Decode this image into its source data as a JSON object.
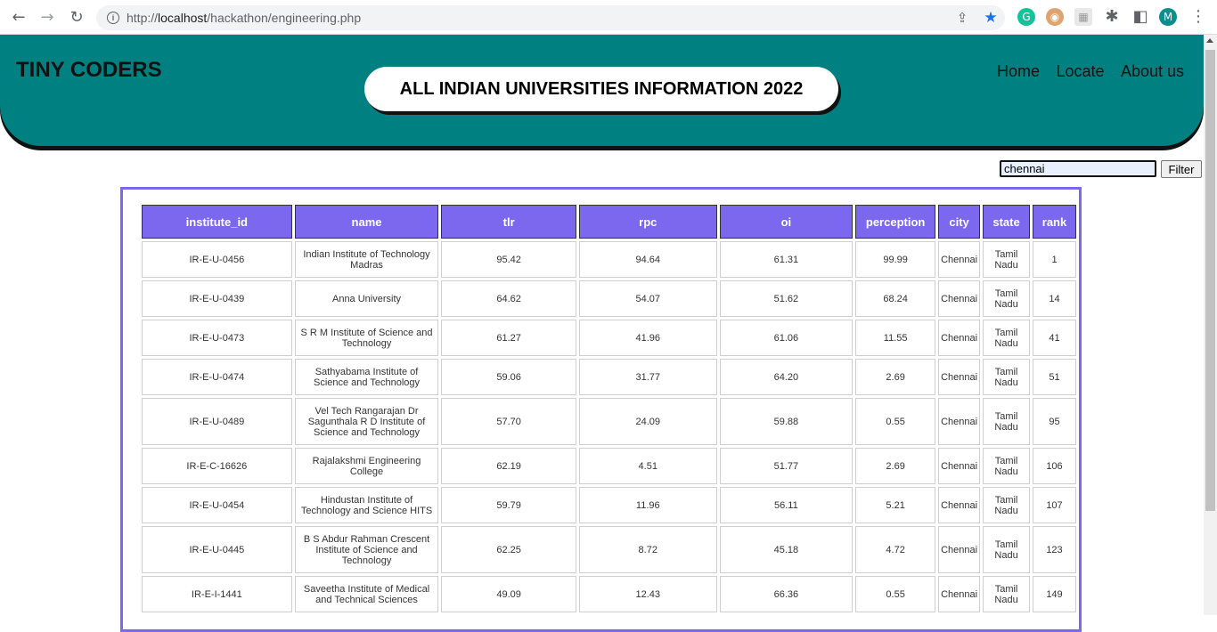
{
  "browser": {
    "url_scheme": "http://",
    "url_host": "localhost",
    "url_path": "/hackathon/engineering.php",
    "profile_initial": "M"
  },
  "header": {
    "brand": "TINY CODERS",
    "title": "ALL INDIAN UNIVERSITIES INFORMATION 2022",
    "nav": [
      "Home",
      "Locate",
      "About us"
    ]
  },
  "filter": {
    "value": "chennai",
    "button_label": "Filter"
  },
  "table": {
    "columns": [
      "institute_id",
      "name",
      "tlr",
      "rpc",
      "oi",
      "perception",
      "city",
      "state",
      "rank"
    ],
    "rows": [
      [
        "IR-E-U-0456",
        "Indian Institute of Technology Madras",
        "95.42",
        "94.64",
        "61.31",
        "99.99",
        "Chennai",
        "Tamil Nadu",
        "1"
      ],
      [
        "IR-E-U-0439",
        "Anna University",
        "64.62",
        "54.07",
        "51.62",
        "68.24",
        "Chennai",
        "Tamil Nadu",
        "14"
      ],
      [
        "IR-E-U-0473",
        "S R M Institute of Science and Technology",
        "61.27",
        "41.96",
        "61.06",
        "11.55",
        "Chennai",
        "Tamil Nadu",
        "41"
      ],
      [
        "IR-E-U-0474",
        "Sathyabama Institute of Science and Technology",
        "59.06",
        "31.77",
        "64.20",
        "2.69",
        "Chennai",
        "Tamil Nadu",
        "51"
      ],
      [
        "IR-E-U-0489",
        "Vel Tech Rangarajan Dr Sagunthala R D Institute of Science and Technology",
        "57.70",
        "24.09",
        "59.88",
        "0.55",
        "Chennai",
        "Tamil Nadu",
        "95"
      ],
      [
        "IR-E-C-16626",
        "Rajalakshmi Engineering College",
        "62.19",
        "4.51",
        "51.77",
        "2.69",
        "Chennai",
        "Tamil Nadu",
        "106"
      ],
      [
        "IR-E-U-0454",
        "Hindustan Institute of Technology and Science HITS",
        "59.79",
        "11.96",
        "56.11",
        "5.21",
        "Chennai",
        "Tamil Nadu",
        "107"
      ],
      [
        "IR-E-U-0445",
        "B S Abdur Rahman Crescent Institute of Science and Technology",
        "62.25",
        "8.72",
        "45.18",
        "4.72",
        "Chennai",
        "Tamil Nadu",
        "123"
      ],
      [
        "IR-E-I-1441",
        "Saveetha Institute of Medical and Technical Sciences",
        "49.09",
        "12.43",
        "66.36",
        "0.55",
        "Chennai",
        "Tamil Nadu",
        "149"
      ]
    ]
  }
}
